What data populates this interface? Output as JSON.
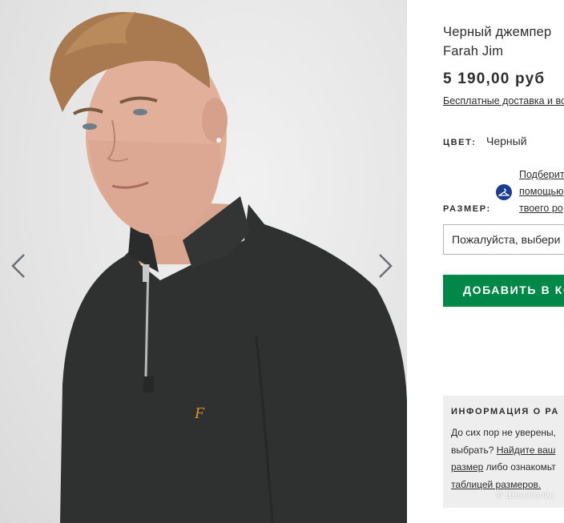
{
  "product": {
    "title_line1": "Черный джемпер",
    "title_line2": "Farah Jim",
    "price": "5 190,00 руб",
    "delivery_link": "Бесплатные доставка и во"
  },
  "color": {
    "label": "ЦВЕТ:",
    "value": "Черный"
  },
  "fit_assistant": {
    "line1": "Подберит",
    "line2": "помощью",
    "line3": "твоего ро"
  },
  "size": {
    "label": "РАЗМЕР:",
    "placeholder": "Пожалуйста, выбери"
  },
  "add_to_bag": {
    "label": "ДОБАВИТЬ В КО"
  },
  "size_info": {
    "title": "ИНФОРМАЦИЯ О РА",
    "line1": "До сих пор не уверены,",
    "line2_a": "выбрать? ",
    "line2_b": "Найдите ваш",
    "line3_a": "размер",
    "line3_b": " либо ознакомьт",
    "line4": "таблицей размеров."
  },
  "watermark": "© Шопоголик",
  "colors": {
    "button_green": "#018849",
    "text_dark": "#2d2d2d",
    "fit_icon_blue": "#1a3d8f",
    "sweater": "#2f3130",
    "logo_orange": "#e0902a"
  },
  "icons": [
    "chevron-left-icon",
    "chevron-right-icon",
    "hanger-icon"
  ]
}
